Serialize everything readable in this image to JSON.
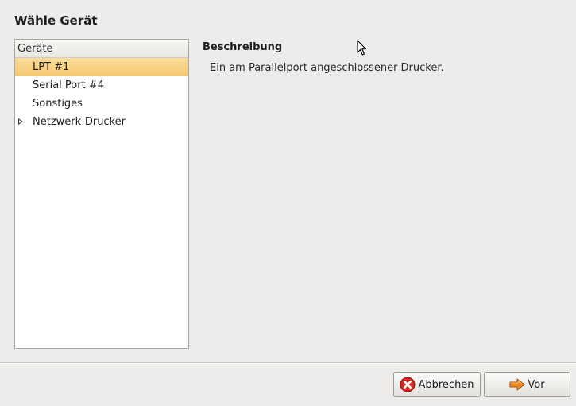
{
  "title": "Wähle Gerät",
  "device_list": {
    "header": "Geräte",
    "items": [
      {
        "label": "LPT #1",
        "selected": true,
        "expandable": false
      },
      {
        "label": "Serial Port #4",
        "selected": false,
        "expandable": false
      },
      {
        "label": "Sonstiges",
        "selected": false,
        "expandable": false
      },
      {
        "label": "Netzwerk-Drucker",
        "selected": false,
        "expandable": true
      }
    ]
  },
  "description": {
    "heading": "Beschreibung",
    "text": "Ein am Parallelport angeschlossener Drucker."
  },
  "buttons": {
    "cancel": {
      "mnemonic": "A",
      "rest": "bbrechen",
      "icon": "cancel-icon"
    },
    "forward": {
      "mnemonic": "V",
      "rest": "or",
      "icon": "forward-arrow-icon"
    }
  },
  "colors": {
    "selection": "#f8d38b",
    "cancel_icon": "#d8261e",
    "forward_arrow": "#f08a1c"
  }
}
